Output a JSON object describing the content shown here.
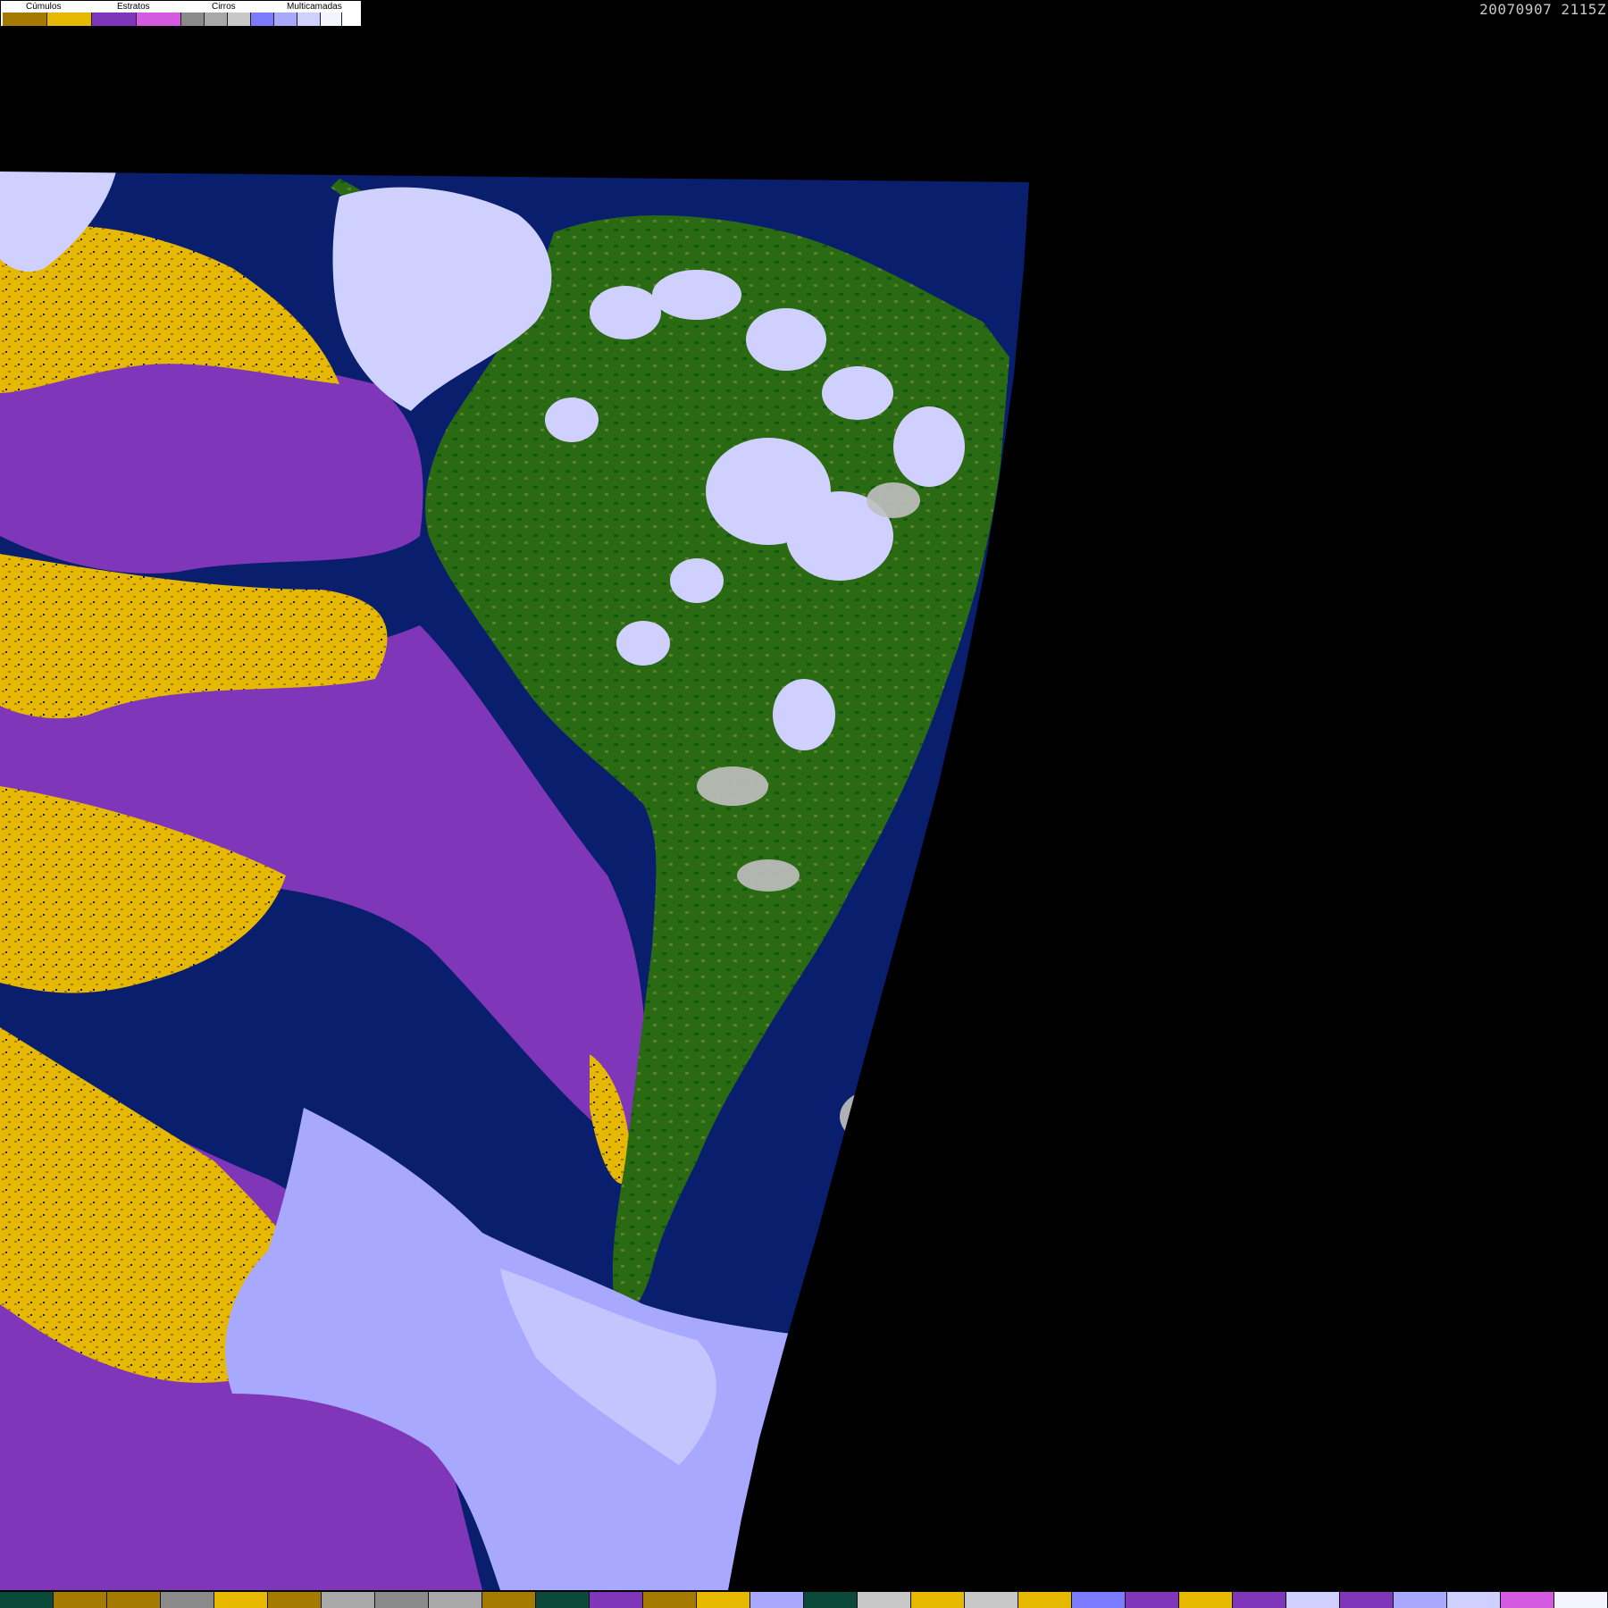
{
  "timestamp": "20070907 2115Z",
  "legend": {
    "groups": [
      {
        "label": "Cúmulos",
        "colors": [
          "#a47a00",
          "#e6b800"
        ]
      },
      {
        "label": "Estratos",
        "colors": [
          "#8036b8",
          "#d45ae0"
        ]
      },
      {
        "label": "Cirros",
        "colors": [
          "#8a8a8a",
          "#a8a8a8",
          "#c8c8c8"
        ]
      },
      {
        "label": "Multicamadas",
        "colors": [
          "#7b7bff",
          "#a8a8ff",
          "#d0d0ff",
          "#f4f4ff"
        ]
      }
    ]
  },
  "colors": {
    "ocean": "#0a1e6e",
    "land": "#2a6a12",
    "land_dark": "#0f5a0f",
    "land_light": "#5b7f2a",
    "stratus": "#8036b8",
    "cumulus": "#e6b800",
    "multilayer": "#a8a8ff",
    "multilayer_light": "#d0d0ff",
    "cirrus": "#c0c0c0"
  },
  "bottom_bar": {
    "colors": [
      "#0b4a3a",
      "#a47a00",
      "#a47a00",
      "#8a8a8a",
      "#e6b800",
      "#a47a00",
      "#a8a8a8",
      "#8a8a8a",
      "#a8a8a8",
      "#a47a00",
      "#0b4a3a",
      "#8036b8",
      "#a47a00",
      "#e6b800",
      "#a8a8ff",
      "#0b4a3a",
      "#c8c8c8",
      "#e6b800",
      "#c8c8c8",
      "#e6b800",
      "#7b7bff",
      "#8036b8",
      "#e6b800",
      "#8036b8",
      "#d0d0ff",
      "#8036b8",
      "#a8a8ff",
      "#d0d0ff",
      "#d45ae0",
      "#f4f4ff"
    ]
  }
}
